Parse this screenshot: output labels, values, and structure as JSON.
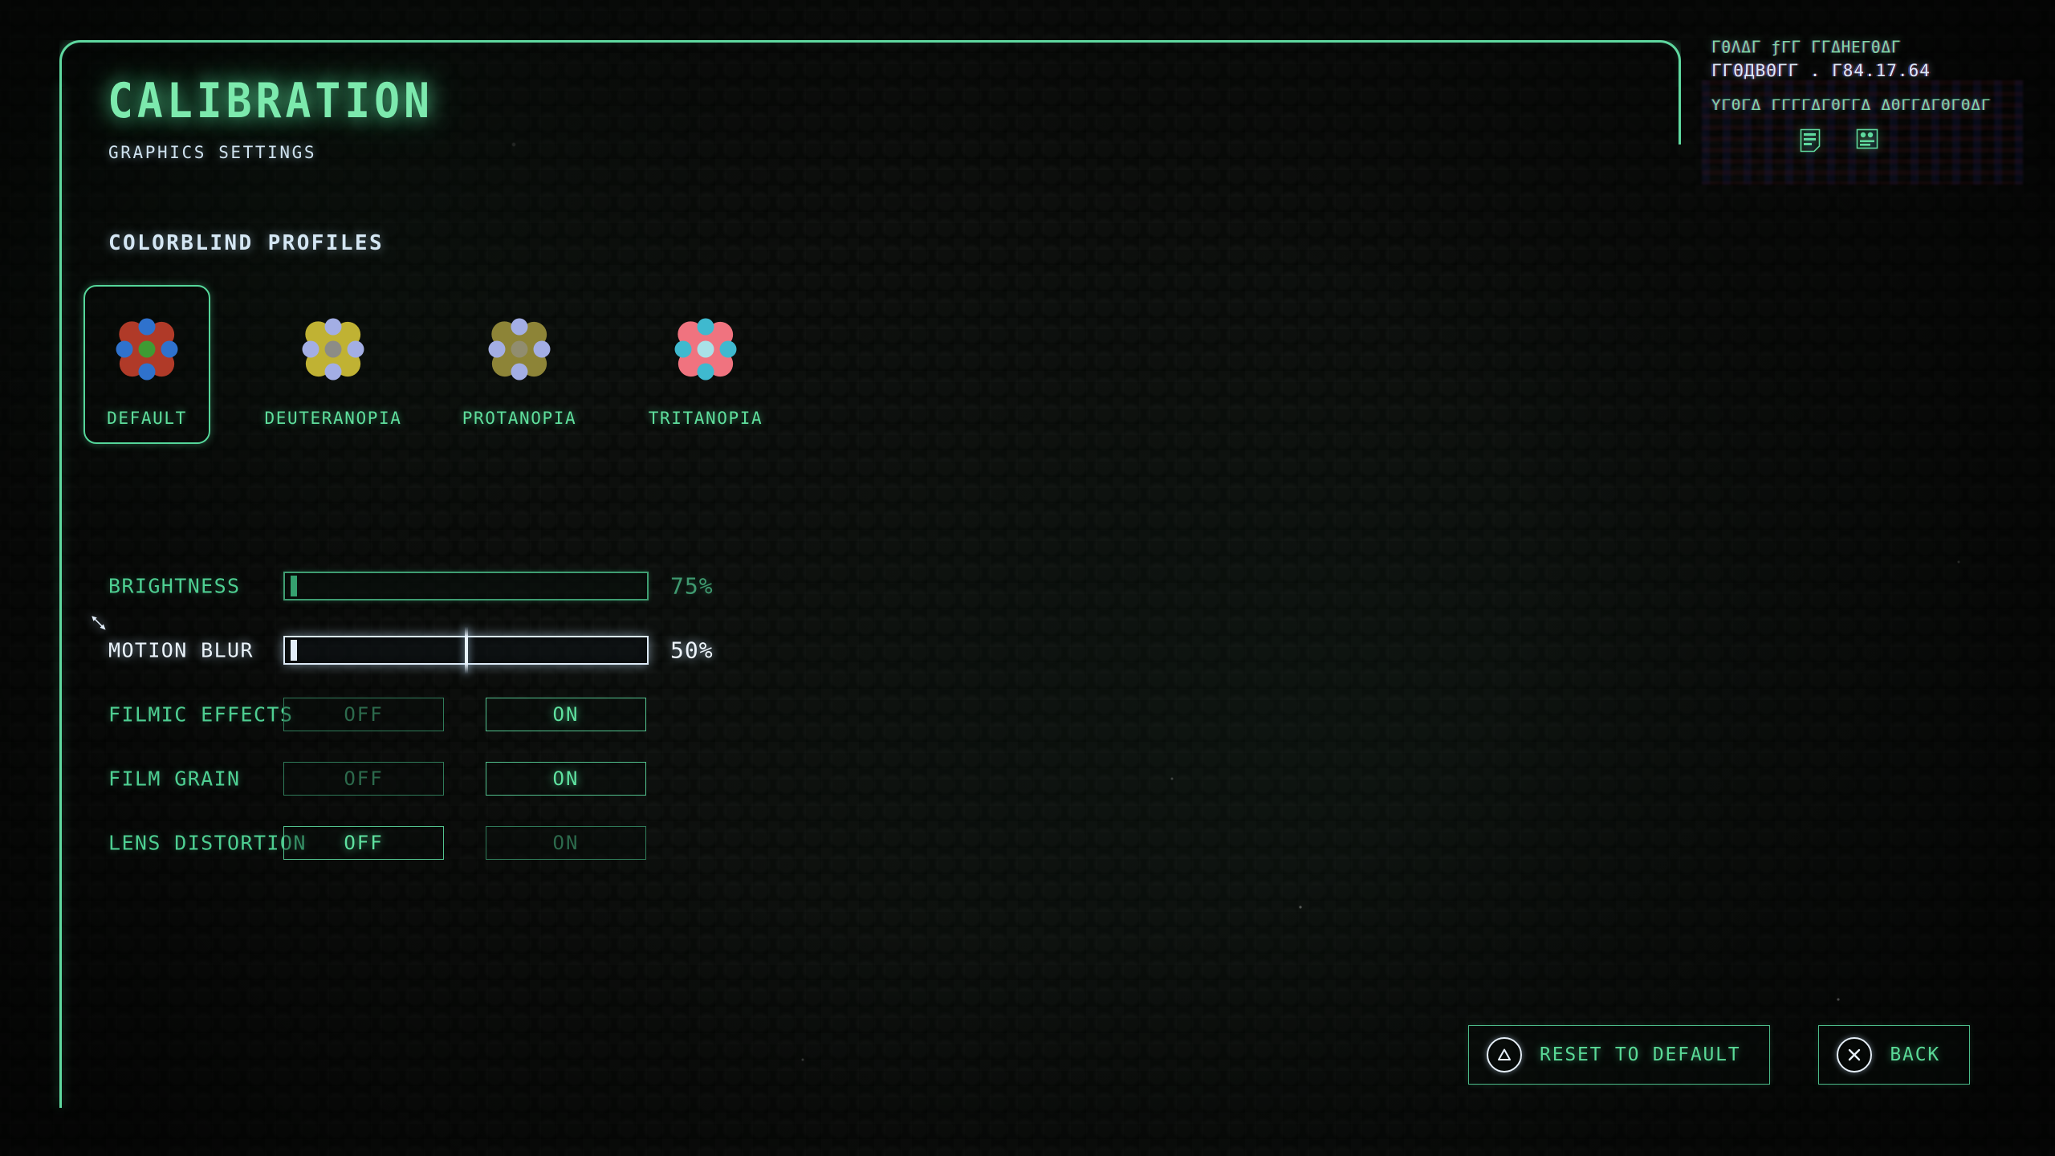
{
  "header": {
    "title": "CALIBRATION",
    "subtitle": "GRAPHICS SETTINGS"
  },
  "sections": {
    "colorblind_title": "COLORBLIND PROFILES"
  },
  "profiles": [
    {
      "label": "DEFAULT",
      "selected": true,
      "petal_color": "#b03a28",
      "dot_color": "#2f72cd",
      "center_color": "#3f9b33"
    },
    {
      "label": "DEUTERANOPIA",
      "selected": false,
      "petal_color": "#c0b233",
      "dot_color": "#a3aee4",
      "center_color": "#8c8c86"
    },
    {
      "label": "PROTANOPIA",
      "selected": false,
      "petal_color": "#8d8437",
      "dot_color": "#a3aee4",
      "center_color": "#918d6f"
    },
    {
      "label": "TRITANOPIA",
      "selected": false,
      "petal_color": "#f0737f",
      "dot_color": "#3fb9cf",
      "center_color": "#a9e2e8"
    }
  ],
  "settings": [
    {
      "label": "BRIGHTNESS",
      "type": "slider",
      "value": 75,
      "value_text": "75%",
      "focused": false
    },
    {
      "label": "MOTION BLUR",
      "type": "slider",
      "value": 50,
      "value_text": "50%",
      "focused": true
    },
    {
      "label": "FILMIC EFFECTS",
      "type": "toggle",
      "off_label": "OFF",
      "on_label": "ON",
      "selected": "ON"
    },
    {
      "label": "FILM GRAIN",
      "type": "toggle",
      "off_label": "OFF",
      "on_label": "ON",
      "selected": "ON"
    },
    {
      "label": "LENS DISTORTION",
      "type": "toggle",
      "off_label": "OFF",
      "on_label": "ON",
      "selected": "OFF"
    }
  ],
  "prompts": [
    {
      "icon": "triangle-button-icon",
      "label": "RESET TO DEFAULT"
    },
    {
      "icon": "cross-button-icon",
      "label": "BACK"
    }
  ],
  "hud": {
    "line1": "ΓΘΛΔΓ  ƒГΓ  ΓΓΔΗЕГΘΔΓ",
    "line2": "ГΓΘДΒΘΓГ . Γ84.17.64",
    "line3": "ΥГΘΓΔ ΓГΓΓΔΓΘΓΓΔ ΔΘΓΓΔΓΘΓΘΔΓ",
    "icon1": "document-lines-icon",
    "icon2": "profile-card-icon"
  },
  "colors": {
    "accent_green": "#5fd9a0",
    "focus_white": "#eaf3fb",
    "dim_green": "#3f9a70"
  }
}
